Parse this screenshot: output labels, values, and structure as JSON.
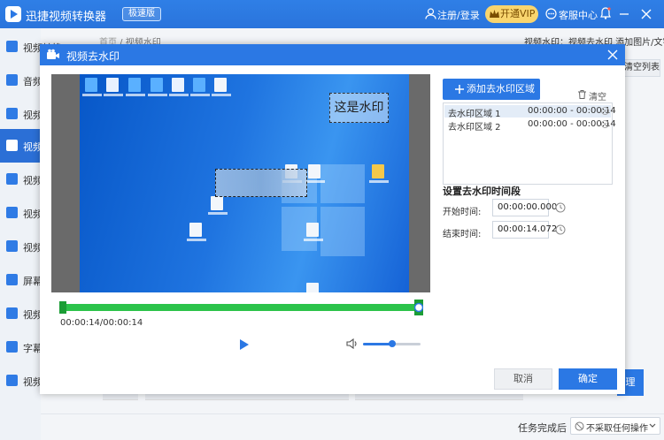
{
  "app": {
    "title": "迅捷视频转换器",
    "edition": "极速版",
    "login": "注册/登录",
    "vip": "开通VIP",
    "service": "客服中心"
  },
  "sidebar": {
    "items": [
      {
        "label": "视频转换"
      },
      {
        "label": "音频"
      },
      {
        "label": "视频"
      },
      {
        "label": "视频"
      },
      {
        "label": "视频"
      },
      {
        "label": "视频"
      },
      {
        "label": "视频"
      },
      {
        "label": "屏幕"
      },
      {
        "label": "视频"
      },
      {
        "label": "字幕"
      },
      {
        "label": "视频"
      }
    ]
  },
  "main": {
    "breadcrumb_home": "首页",
    "breadcrumb_current": "视频水印",
    "feature_desc": "视频水印：视频去水印 添加图片/文字水印",
    "clear_list": "清空列表",
    "ok_partial": "理",
    "after_task_label": "任务完成后",
    "after_task_value": "不采取任何操作"
  },
  "modal": {
    "title": "视频去水印",
    "watermark_text": "这是水印",
    "time_readout": "00:00:14/00:00:14",
    "add_region": "添加去水印区域",
    "clear_regions": "清空",
    "regions": [
      {
        "name": "去水印区域 1",
        "time": "00:00:00 - 00:00:14"
      },
      {
        "name": "去水印区域 2",
        "time": "00:00:00 - 00:00:14"
      }
    ],
    "section_title": "设置去水印时间段",
    "start_label": "开始时间:",
    "start_value": "00:00:00.000",
    "end_label": "结束时间:",
    "end_value": "00:00:14.072",
    "cancel": "取消",
    "confirm": "确定",
    "volume_level": 0.5
  },
  "colors": {
    "accent": "#2b78e4",
    "timeline": "#2cc34a",
    "vip": "#f9d56e"
  }
}
